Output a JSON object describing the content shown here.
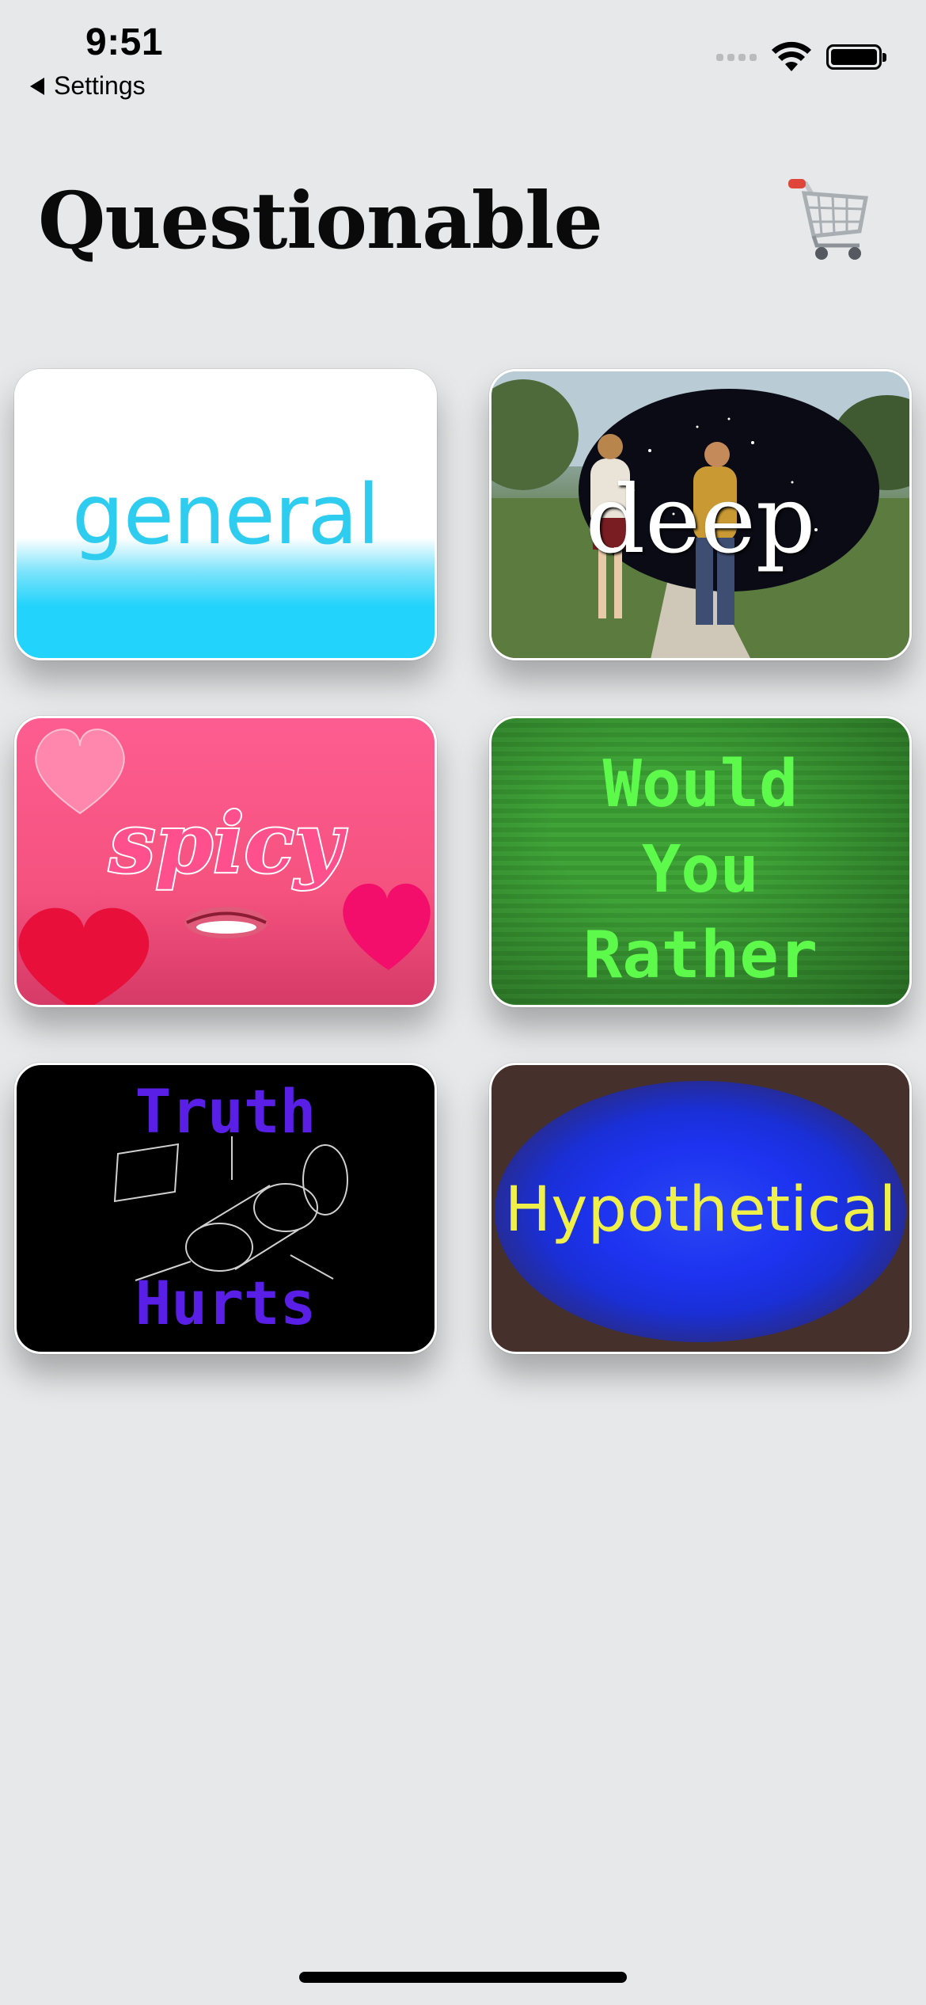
{
  "status_bar": {
    "time": "9:51",
    "back_label": "Settings"
  },
  "header": {
    "title": "Questionable",
    "cart_icon": "shopping-cart-icon"
  },
  "categories": [
    {
      "label": "general",
      "style": "white-to-cyan gradient",
      "color": "#2ecdf0"
    },
    {
      "label": "deep",
      "style": "photo of couple walking with starry circle",
      "color": "#ffffff"
    },
    {
      "label": "spicy",
      "style": "pink with hearts and lips",
      "color": "#ff4f8c"
    },
    {
      "label_lines": [
        "Would",
        "You",
        "Rather"
      ],
      "style": "green crt stripes",
      "color": "#5dfa4c"
    },
    {
      "label_lines": [
        "Truth",
        "Hurts"
      ],
      "style": "black with wireframe shapes",
      "color": "#5a1fe6"
    },
    {
      "label": "Hypothetical",
      "style": "brown with blue glow",
      "color": "#f0f04a"
    }
  ]
}
